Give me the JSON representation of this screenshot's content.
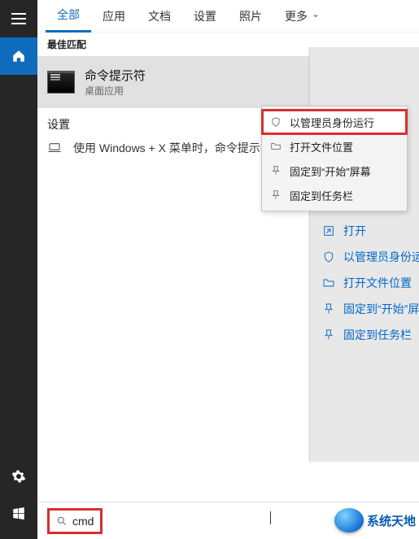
{
  "tabs": {
    "all": "全部",
    "apps": "应用",
    "docs": "文档",
    "settings": "设置",
    "photos": "照片",
    "more": "更多"
  },
  "best_match_header": "最佳匹配",
  "result": {
    "title": "命令提示符",
    "subtitle": "桌面应用"
  },
  "settings_header": "设置",
  "settings_item": "使用 Windows + X 菜单时，命令提示符替换为 Windows",
  "context_menu": {
    "run_as_admin": "以管理员身份运行",
    "open_location": "打开文件位置",
    "pin_start": "固定到“开始”屏幕",
    "pin_taskbar": "固定到任务栏"
  },
  "panel_actions": {
    "open": "打开",
    "run_as_admin": "以管理员身份运行",
    "open_location": "打开文件位置",
    "pin_start": "固定到“开始”屏幕",
    "pin_taskbar": "固定到任务栏"
  },
  "search_value": "cmd",
  "watermark": "系统天地"
}
